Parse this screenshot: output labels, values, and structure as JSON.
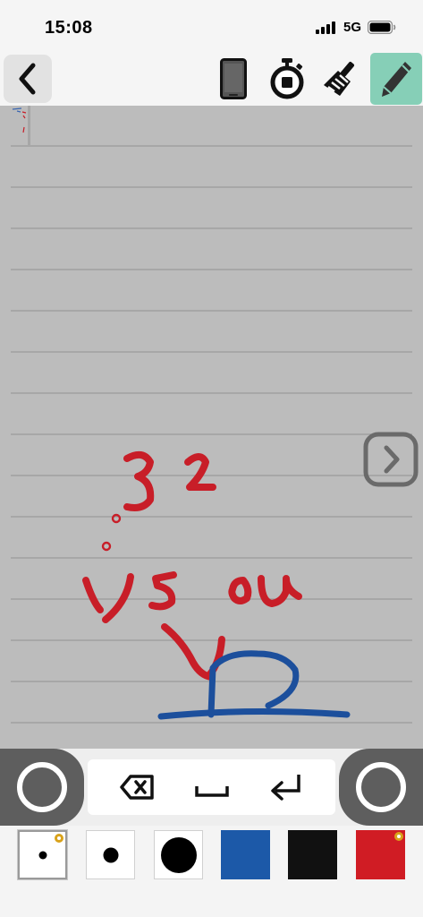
{
  "status_bar": {
    "time": "15:08",
    "network": "5G"
  },
  "toolbar": {
    "back_icon": "chevron-left-icon",
    "tools": [
      {
        "name": "device",
        "icon": "phone-icon"
      },
      {
        "name": "timer",
        "icon": "stopwatch-icon"
      },
      {
        "name": "clear",
        "icon": "broom-icon"
      },
      {
        "name": "pen",
        "icon": "pencil-icon",
        "active": true
      }
    ],
    "active_color": "#86cfb7"
  },
  "canvas": {
    "background": "#bcbcbc",
    "line_color": "#9a9a9a",
    "ink_colors": [
      "#c81e28",
      "#1c4f9c"
    ]
  },
  "keys": [
    {
      "name": "backspace",
      "icon": "backspace-icon"
    },
    {
      "name": "space",
      "icon": "space-icon"
    },
    {
      "name": "return",
      "icon": "return-icon"
    }
  ],
  "palette": {
    "pen_sizes": [
      "small",
      "medium",
      "large"
    ],
    "colors": [
      "#1c59a8",
      "#111111",
      "#d01c24"
    ],
    "selected_size": "small",
    "selected_color": "#d01c24"
  }
}
